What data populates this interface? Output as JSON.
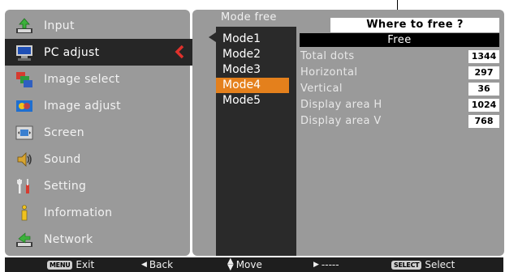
{
  "menu": {
    "items": [
      {
        "label": "Input",
        "icon": "input-icon"
      },
      {
        "label": "PC adjust",
        "icon": "pc-adjust-icon",
        "selected": true
      },
      {
        "label": "Image select",
        "icon": "image-select-icon"
      },
      {
        "label": "Image adjust",
        "icon": "image-adjust-icon"
      },
      {
        "label": "Screen",
        "icon": "screen-icon"
      },
      {
        "label": "Sound",
        "icon": "sound-icon"
      },
      {
        "label": "Setting",
        "icon": "setting-icon"
      },
      {
        "label": "Information",
        "icon": "information-icon"
      },
      {
        "label": "Network",
        "icon": "network-icon"
      }
    ]
  },
  "submenu": {
    "header": "Mode free",
    "modes": [
      "Mode1",
      "Mode2",
      "Mode3",
      "Mode4",
      "Mode5"
    ],
    "selected_mode": "Mode4"
  },
  "free_panel": {
    "where_title": "Where to free ?",
    "status": "Free",
    "params": [
      {
        "label": "Total dots",
        "value": "1344"
      },
      {
        "label": "Horizontal",
        "value": "297"
      },
      {
        "label": "Vertical",
        "value": "36"
      },
      {
        "label": "Display area H",
        "value": "1024"
      },
      {
        "label": "Display area V",
        "value": "768"
      }
    ]
  },
  "bottom_bar": {
    "exit_key": "MENU",
    "exit_label": "Exit",
    "back_label": "Back",
    "move_label": "Move",
    "next_label": "-----",
    "select_key": "SELECT",
    "select_label": "Select"
  },
  "colors": {
    "panel_bg": "#9a9a9a",
    "selected_bg": "#262626",
    "accent": "#e4801c",
    "chevron": "#e0312c"
  }
}
